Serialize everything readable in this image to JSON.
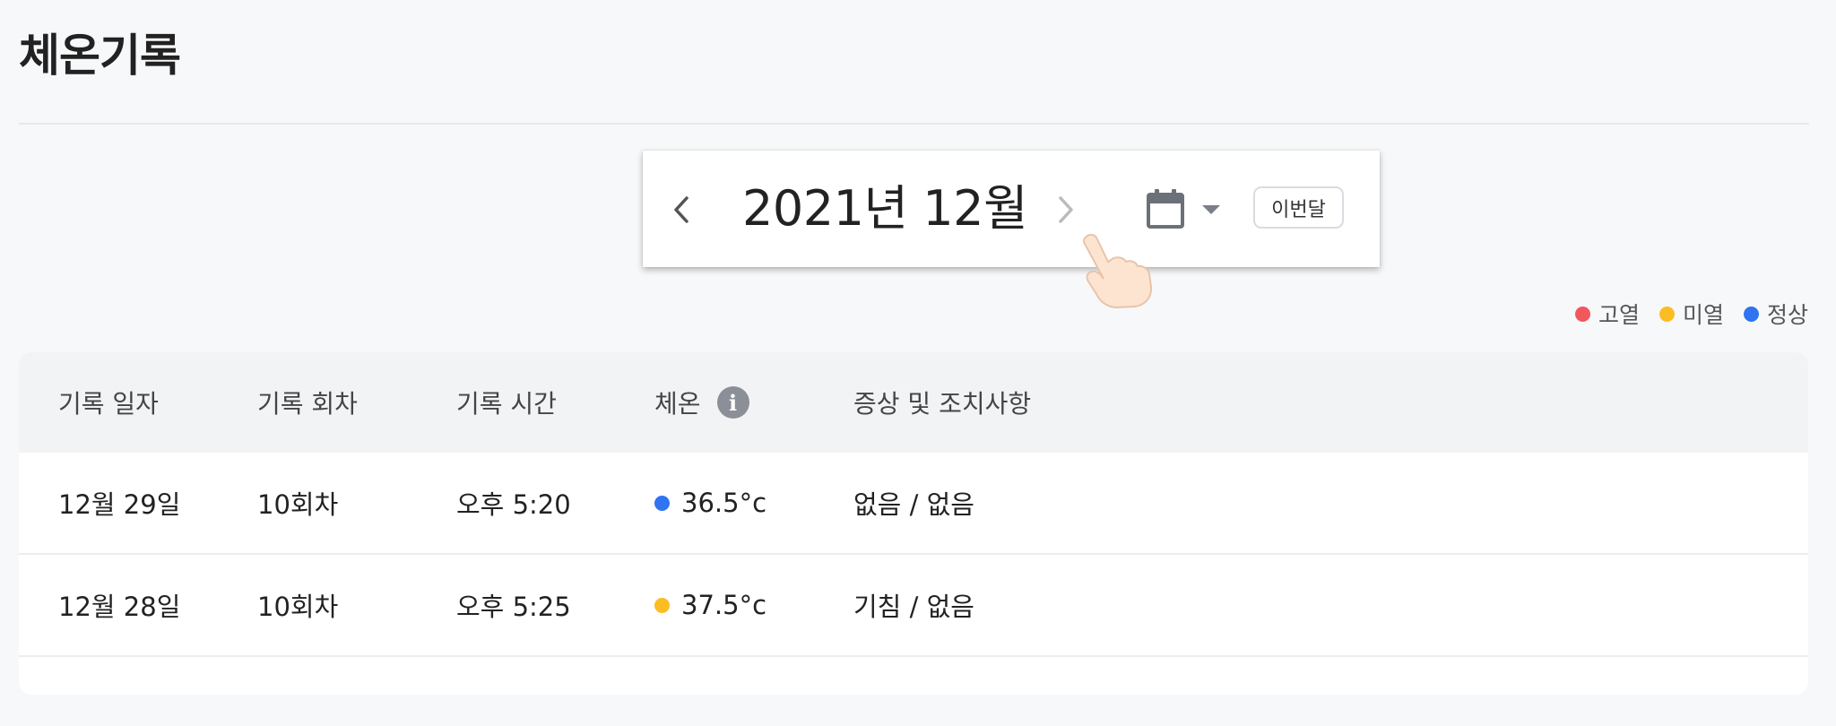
{
  "page": {
    "title": "체온기록"
  },
  "month_nav": {
    "label": "2021년 12월",
    "prev_icon": "chevron-left-icon",
    "next_icon": "chevron-right-icon",
    "calendar_icon": "calendar-icon",
    "this_month_label": "이번달"
  },
  "legend": [
    {
      "label": "고열",
      "color": "#f0585e"
    },
    {
      "label": "미열",
      "color": "#fbbd23"
    },
    {
      "label": "정상",
      "color": "#2f74f0"
    }
  ],
  "table": {
    "headers": [
      "기록 일자",
      "기록 회차",
      "기록 시간",
      "체온",
      "증상 및 조치사항"
    ],
    "info_icon": "info-icon",
    "rows": [
      {
        "date": "12월 29일",
        "round": "10회차",
        "time": "오후 5:20",
        "temp": "36.5°c",
        "status_color": "#2f74f0",
        "symptoms": "없음 / 없음"
      },
      {
        "date": "12월 28일",
        "round": "10회차",
        "time": "오후 5:25",
        "temp": "37.5°c",
        "status_color": "#fbbd23",
        "symptoms": "기침 / 없음"
      }
    ]
  }
}
